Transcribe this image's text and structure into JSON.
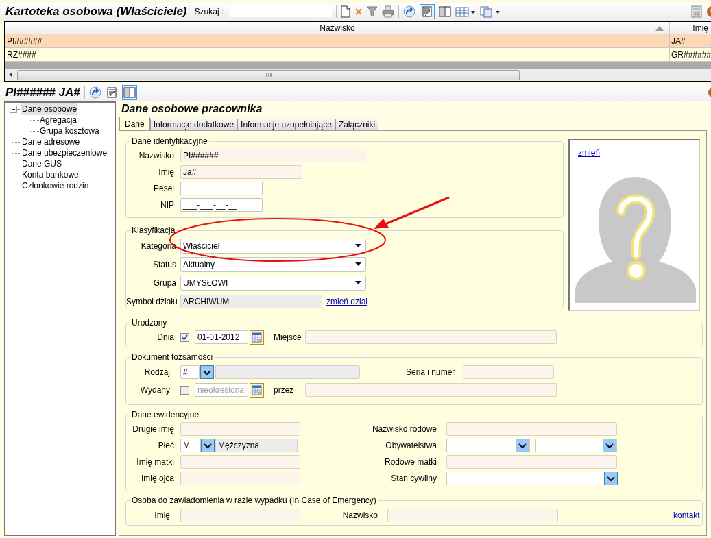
{
  "header": {
    "title": "Kartoteka osobowa (Właściciele)",
    "search_label": "Szukaj :"
  },
  "table": {
    "columns": [
      {
        "label": "Nazwisko",
        "sorted": true
      },
      {
        "label": "Imię",
        "sorted": false
      }
    ],
    "rows": [
      {
        "cells": [
          "PI######",
          "JA#"
        ],
        "selected": true
      },
      {
        "cells": [
          "RZ####",
          "GR######"
        ],
        "selected": false
      }
    ]
  },
  "record": {
    "title": "PI###### JA#"
  },
  "sidebar": {
    "items": [
      {
        "label": "Dane osobowe",
        "selected": true,
        "expanded": true,
        "children": [
          {
            "label": "Agregacja",
            "selected": false
          },
          {
            "label": "Grupa kosztowa",
            "selected": false
          }
        ]
      },
      {
        "label": "Dane adresowe",
        "selected": false
      },
      {
        "label": "Dane ubezpieczeniowe",
        "selected": false
      },
      {
        "label": "Dane GUS",
        "selected": false
      },
      {
        "label": "Konta bankowe",
        "selected": false
      },
      {
        "label": "Członkowie rodzin",
        "selected": false
      }
    ]
  },
  "section_title": "Dane osobowe pracownika",
  "tabs": [
    {
      "label": "Dane",
      "selected": true
    },
    {
      "label": "Informacje dodatkowe",
      "selected": false
    },
    {
      "label": "Informacje uzupełniające",
      "selected": false
    },
    {
      "label": "Załączniki",
      "selected": false
    }
  ],
  "identification": {
    "legend": "Dane identyfikacyjne",
    "fields": [
      {
        "label": "Nazwisko",
        "kind": "text",
        "value": "PI######"
      },
      {
        "label": "Imię",
        "kind": "text",
        "value": "Ja#"
      },
      {
        "label": "Pesel",
        "kind": "masked",
        "value": "___________"
      },
      {
        "label": "NIP",
        "kind": "masked",
        "value": "___-___-__-__"
      }
    ]
  },
  "classification": {
    "legend": "Klasyfikacja",
    "fields": [
      {
        "label": "Kategoria",
        "kind": "combo",
        "value": "Właściciel"
      },
      {
        "label": "Status",
        "kind": "combo",
        "value": "Aktualny"
      },
      {
        "label": "Grupa",
        "kind": "combo",
        "value": "UMYSŁOWI"
      },
      {
        "label": "Symbol działu",
        "kind": "readonly",
        "value": "ARCHIWUM",
        "link": "zmień dział"
      }
    ]
  },
  "photo": {
    "link": "zmień"
  },
  "birth": {
    "legend": "Urodzony",
    "date": {
      "label": "Dnia",
      "checked": true,
      "value": "01-01-2012"
    },
    "place": {
      "label": "Miejsce"
    }
  },
  "document": {
    "legend": "Dokument tożsamości",
    "type": {
      "label": "Rodzaj",
      "code": "#"
    },
    "number": {
      "label": "Seria i numer"
    },
    "issued": {
      "label": "Wydany",
      "checked": false,
      "placeholder": "nieokreślona"
    },
    "issuer": {
      "label": "przez"
    }
  },
  "records": {
    "legend": "Dane ewidencyjne",
    "left": [
      {
        "label": "Drugie imię",
        "kind": "text"
      },
      {
        "label": "Płeć",
        "kind": "lookup",
        "code": "M",
        "value": "Mężczyzna"
      },
      {
        "label": "Imię matki",
        "kind": "text"
      },
      {
        "label": "Imię ojca",
        "kind": "text"
      }
    ],
    "right": [
      {
        "label": "Nazwisko rodowe",
        "kind": "text"
      },
      {
        "label": "Obywatelstwa",
        "kind": "double_combo"
      },
      {
        "label": "Rodowe matki",
        "kind": "text"
      },
      {
        "label": "Stan cywilny",
        "kind": "combo"
      }
    ]
  },
  "emergency": {
    "legend": "Osoba do zawiadomienia w razie wypadku (In Case of Emergency)",
    "first": {
      "label": "Imię"
    },
    "last": {
      "label": "Nazwisko"
    },
    "link": "kontakt"
  }
}
